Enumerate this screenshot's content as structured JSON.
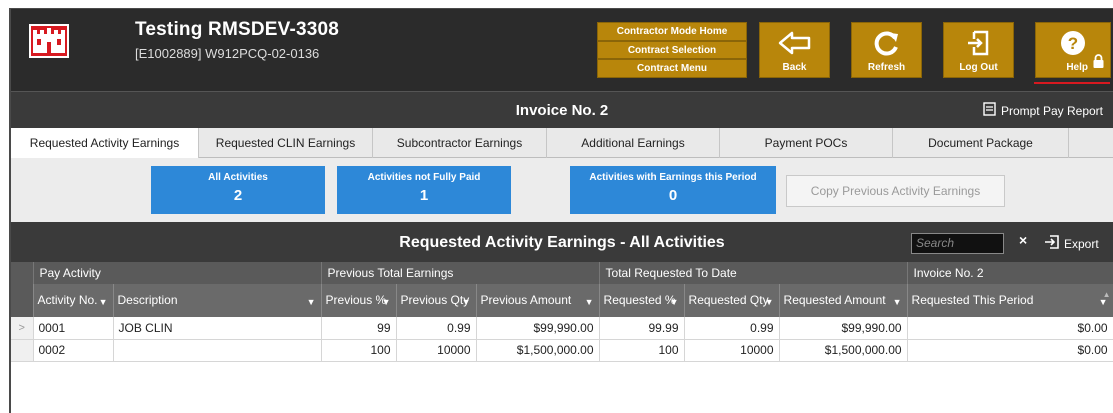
{
  "header": {
    "title": "Testing RMSDEV-3308",
    "subtitle": "[E1002889] W912PCQ-02-0136",
    "menu": [
      "Contractor Mode Home",
      "Contract Selection",
      "Contract Menu"
    ],
    "buttons": {
      "back": "Back",
      "refresh": "Refresh",
      "logout": "Log Out",
      "help": "Help"
    },
    "accent_color": "#b8860b",
    "logo_color": "#d71920"
  },
  "invoice": {
    "title": "Invoice No. 2",
    "prompt_pay_label": "Prompt Pay Report"
  },
  "tabs": [
    "Requested Activity Earnings",
    "Requested CLIN Earnings",
    "Subcontractor Earnings",
    "Additional Earnings",
    "Payment POCs",
    "Document Package"
  ],
  "filters": [
    {
      "label": "All Activities",
      "count": "2"
    },
    {
      "label": "Activities not Fully Paid",
      "count": "1"
    },
    {
      "label": "Activities with Earnings this Period",
      "count": "0"
    }
  ],
  "copy_button": "Copy Previous Activity Earnings",
  "grid": {
    "title": "Requested Activity Earnings - All Activities",
    "search_placeholder": "Search",
    "clear": "×",
    "export_label": "Export",
    "groups": [
      "Pay Activity",
      "Previous Total Earnings",
      "Total Requested To Date",
      "Invoice No. 2"
    ],
    "columns": [
      "Activity No.",
      "Description",
      "Previous %",
      "Previous Qty",
      "Previous Amount",
      "Requested %",
      "Requested Qty",
      "Requested Amount",
      "Requested This Period"
    ],
    "rows": [
      {
        "marker": ">",
        "cells": [
          "0001",
          "JOB CLIN",
          "99",
          "0.99",
          "$99,990.00",
          "99.99",
          "0.99",
          "$99,990.00",
          "$0.00"
        ]
      },
      {
        "marker": "",
        "cells": [
          "0002",
          "",
          "100",
          "10000",
          "$1,500,000.00",
          "100",
          "10000",
          "$1,500,000.00",
          "$0.00"
        ]
      }
    ]
  }
}
